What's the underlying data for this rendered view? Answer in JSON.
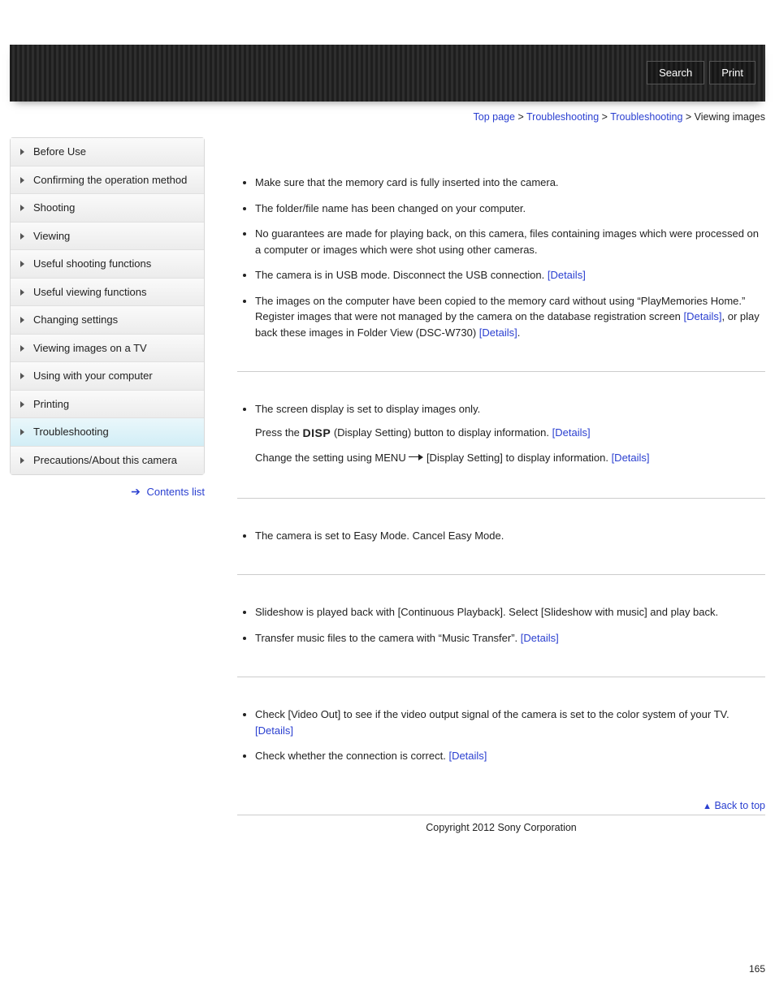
{
  "header": {
    "search": "Search",
    "print": "Print"
  },
  "breadcrumb": {
    "items": [
      "Top page",
      "Troubleshooting",
      "Troubleshooting"
    ],
    "current": "Viewing images",
    "sep": " > "
  },
  "sidebar": {
    "items": [
      "Before Use",
      "Confirming the operation method",
      "Shooting",
      "Viewing",
      "Useful shooting functions",
      "Useful viewing functions",
      "Changing settings",
      "Viewing images on a TV",
      "Using with your computer",
      "Printing",
      "Troubleshooting",
      "Precautions/About this camera"
    ],
    "active_index": 10,
    "contents_link": "Contents list"
  },
  "sections": {
    "s1": {
      "b1": "Make sure that the memory card is fully inserted into the camera.",
      "b2": "The folder/file name has been changed on your computer.",
      "b3": "No guarantees are made for playing back, on this camera, files containing images which were processed on a computer or images which were shot using other cameras.",
      "b4a": "The camera is in USB mode. Disconnect the USB connection. ",
      "b4_link": "[Details]",
      "b5a": "The images on the computer have been copied to the memory card without using “PlayMemories Home.” Register images that were not managed by the camera on the database registration screen ",
      "b5_link1": "[Details]",
      "b5b": ", or play back these images in Folder View (DSC-W730) ",
      "b5_link2": "[Details]",
      "b5c": "."
    },
    "s2": {
      "b1": "The screen display is set to display images only.",
      "sub1a": "Press the ",
      "disp": "DISP",
      "sub1b": " (Display Setting) button to display information. ",
      "sub1_link": "[Details]",
      "sub2a": "Change the setting using MENU ",
      "sub2b": " [Display Setting] to display information. ",
      "sub2_link": "[Details]"
    },
    "s3": {
      "b1": "The camera is set to Easy Mode. Cancel Easy Mode."
    },
    "s4": {
      "b1": "Slideshow is played back with [Continuous Playback]. Select [Slideshow with music] and play back.",
      "b2a": "Transfer music files to the camera with “Music Transfer”. ",
      "b2_link": "[Details]"
    },
    "s5": {
      "b1a": "Check [Video Out] to see if the video output signal of the camera is set to the color system of your TV. ",
      "b1_link": "[Details]",
      "b2a": "Check whether the connection is correct. ",
      "b2_link": "[Details]"
    }
  },
  "backtop": "Back to top",
  "copyright": "Copyright 2012 Sony Corporation",
  "pagenum": "165"
}
